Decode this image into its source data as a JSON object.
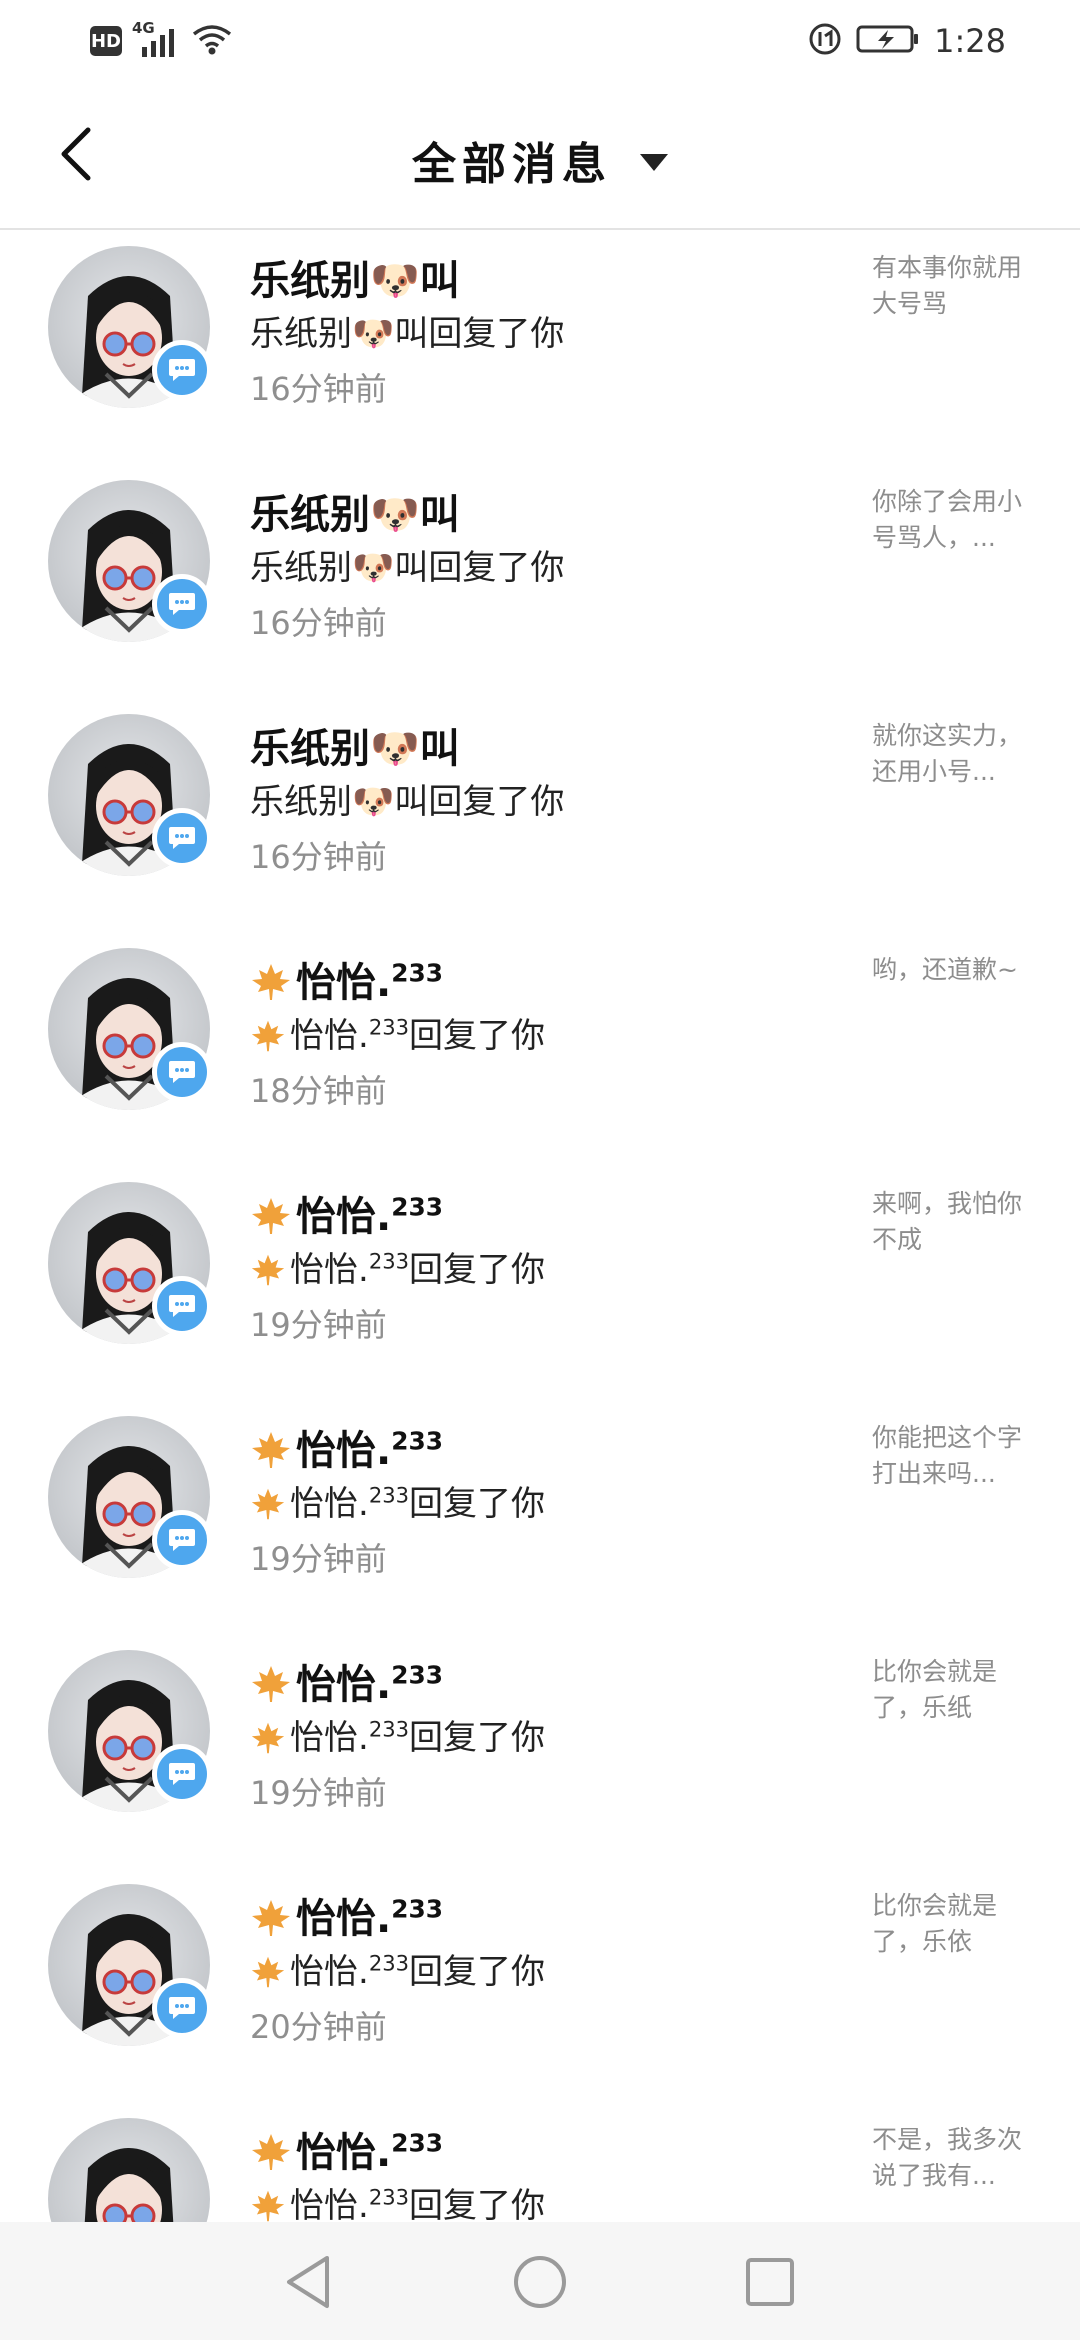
{
  "status_bar": {
    "hd_label": "HD",
    "network_label": "4G",
    "time": "1:28"
  },
  "header": {
    "title": "全部消息"
  },
  "messages": [
    {
      "name": "乐纸别🐶叫",
      "reply": "乐纸别🐶叫回复了你",
      "time": "16分钟前",
      "preview": "有本事你就用大号骂",
      "icon": "dog-emoji-icon"
    },
    {
      "name": "乐纸别🐶叫",
      "reply": "乐纸别🐶叫回复了你",
      "time": "16分钟前",
      "preview": "你除了会用小号骂人，...",
      "icon": "dog-emoji-icon"
    },
    {
      "name": "乐纸别🐶叫",
      "reply": "乐纸别🐶叫回复了你",
      "time": "16分钟前",
      "preview": "就你这实力，还用小号...",
      "icon": "dog-emoji-icon"
    },
    {
      "name": "怡怡.",
      "name_sup": "233",
      "reply": "怡怡.",
      "reply_sup": "233",
      "reply_suffix": "回复了你",
      "time": "18分钟前",
      "preview": "哟，还道歉~",
      "icon": "maple-leaf-icon"
    },
    {
      "name": "怡怡.",
      "name_sup": "233",
      "reply": "怡怡.",
      "reply_sup": "233",
      "reply_suffix": "回复了你",
      "time": "19分钟前",
      "preview": "来啊，我怕你不成",
      "icon": "maple-leaf-icon"
    },
    {
      "name": "怡怡.",
      "name_sup": "233",
      "reply": "怡怡.",
      "reply_sup": "233",
      "reply_suffix": "回复了你",
      "time": "19分钟前",
      "preview": "你能把这个字打出来吗...",
      "icon": "maple-leaf-icon"
    },
    {
      "name": "怡怡.",
      "name_sup": "233",
      "reply": "怡怡.",
      "reply_sup": "233",
      "reply_suffix": "回复了你",
      "time": "19分钟前",
      "preview": "比你会就是了，乐纸",
      "icon": "maple-leaf-icon"
    },
    {
      "name": "怡怡.",
      "name_sup": "233",
      "reply": "怡怡.",
      "reply_sup": "233",
      "reply_suffix": "回复了你",
      "time": "20分钟前",
      "preview": "比你会就是了，乐依",
      "icon": "maple-leaf-icon"
    },
    {
      "name": "怡怡.",
      "name_sup": "233",
      "reply": "怡怡.",
      "reply_sup": "233",
      "reply_suffix": "回复了你",
      "time": "",
      "preview": "不是，我多次说了我有...",
      "icon": "maple-leaf-icon"
    }
  ],
  "colors": {
    "badge": "#4ea7ee",
    "leaf": "#f0a13a",
    "dog": "#f2a44c",
    "muted": "#8f8f8f"
  }
}
